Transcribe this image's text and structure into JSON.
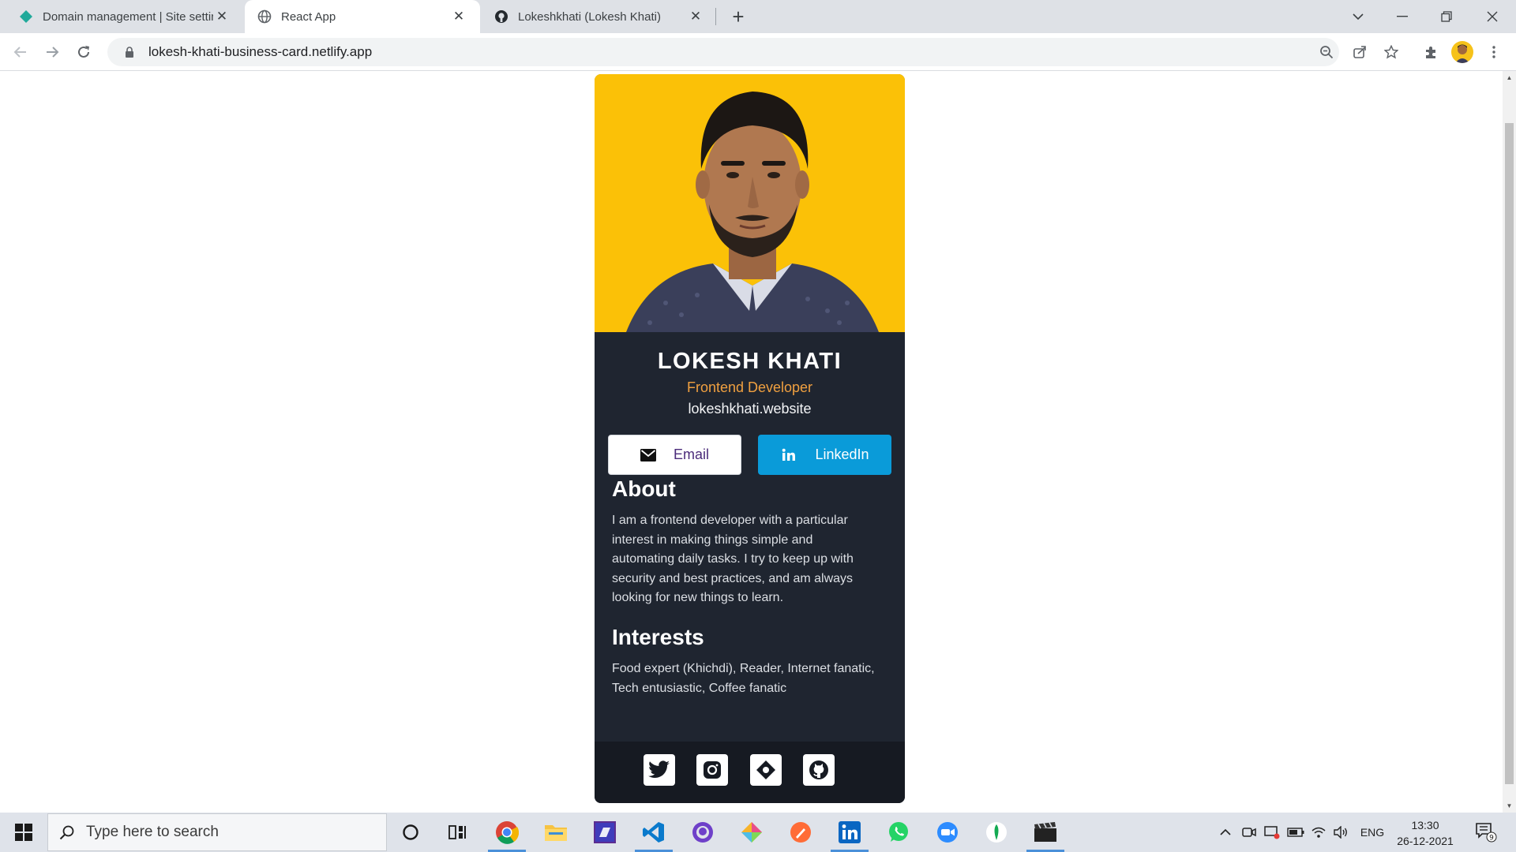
{
  "browser": {
    "tabs": [
      {
        "title": "Domain management | Site settin",
        "active": false
      },
      {
        "title": "React App",
        "active": true
      },
      {
        "title": "Lokeshkhati (Lokesh Khati)",
        "active": false
      }
    ],
    "url": "lokesh-khati-business-card.netlify.app"
  },
  "card": {
    "name": "LOKESH KHATI",
    "role": "Frontend Developer",
    "website": "lokeshkhati.website",
    "buttons": {
      "email": "Email",
      "linkedin": "LinkedIn"
    },
    "about": {
      "heading": "About",
      "lines": [
        "I am a frontend developer with a particular",
        "interest in making things simple and",
        "automating daily tasks. I try to keep up with",
        "security and best practices, and am always",
        "looking for new things to learn."
      ]
    },
    "interests": {
      "heading": "Interests",
      "lines": [
        "Food expert (Khichdi), Reader, Internet fanatic,",
        "Tech entusiastic, Coffee fanatic"
      ]
    },
    "social_icons": [
      "twitter-icon",
      "instagram-icon",
      "hashnode-icon",
      "github-icon"
    ],
    "accent_color": "#f0a040",
    "card_bg": "#1f2530",
    "photo_bg": "#fbc107",
    "linkedin_color": "#0a9bd9"
  },
  "taskbar": {
    "search_placeholder": "Type here to search",
    "apps": [
      "cortana-icon",
      "task-view-icon",
      "chrome-icon",
      "file-explorer-icon",
      "visual-studio-icon",
      "vscode-icon",
      "github-desktop-icon",
      "colorful-app-icon",
      "postman-icon",
      "linkedin-icon",
      "whatsapp-icon",
      "zoom-icon",
      "mongodb-compass-icon",
      "video-editor-icon"
    ],
    "language": "ENG",
    "time": "13:30",
    "date": "26-12-2021",
    "notification_count": "9"
  }
}
